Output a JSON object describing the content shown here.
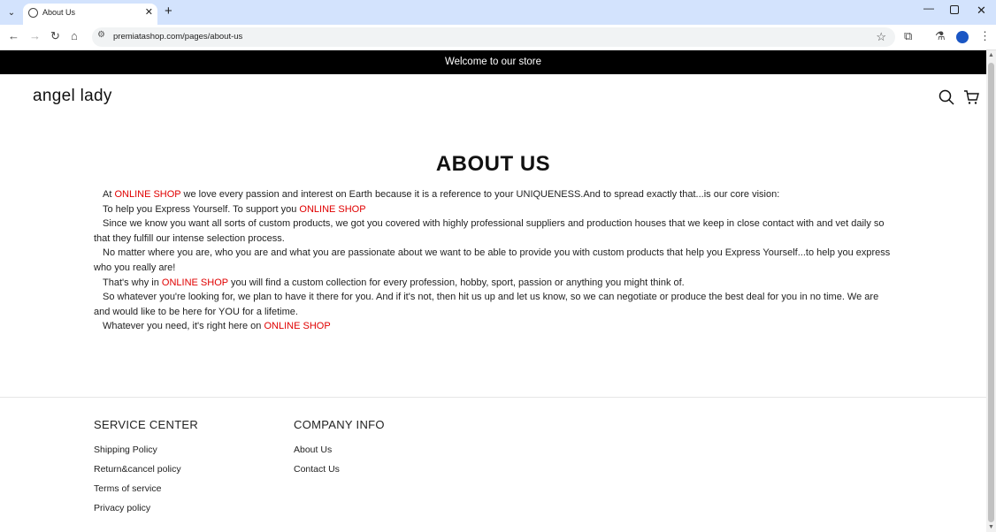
{
  "browser": {
    "tab_title": "About Us",
    "url": "premiatashop.com/pages/about-us"
  },
  "announcement": "Welcome to our store",
  "header": {
    "logo": "angel lady"
  },
  "main": {
    "title": "ABOUT US",
    "paragraphs": [
      {
        "pre": "At ",
        "hl": "ONLINE SHOP",
        "post": " we love every passion and interest on Earth because it is a reference to your UNIQUENESS.And to spread exactly that...is our core vision:"
      },
      {
        "pre": "To help you Express Yourself. To support you ",
        "hl": "ONLINE SHOP",
        "post": ""
      },
      {
        "pre": "Since we know you want all sorts of custom products, we got you covered with highly professional suppliers and production houses that we keep in close contact with and vet daily so that they fulfill our intense selection process.",
        "hl": "",
        "post": ""
      },
      {
        "pre": "No matter where you are, who you are and what you are passionate about we want to be able to provide you with custom products that help you Express Yourself...to help you express who you really are!",
        "hl": "",
        "post": ""
      },
      {
        "pre": "That's why in ",
        "hl": "ONLINE SHOP",
        "post": " you will find a custom collection for every profession, hobby, sport, passion or anything you might think of."
      },
      {
        "pre": "So whatever you're looking for, we plan to have it there for you. And if it's not, then hit us up and let us know, so we can negotiate or produce the best deal for you in no time. We are and would like to be here for YOU for a lifetime.",
        "hl": "",
        "post": ""
      },
      {
        "pre": "Whatever you need, it's right here on ",
        "hl": "ONLINE SHOP",
        "post": ""
      }
    ]
  },
  "footer": {
    "service": {
      "heading": "SERVICE CENTER",
      "links": [
        "Shipping Policy",
        "Return&cancel policy",
        "Terms of service",
        "Privacy policy"
      ]
    },
    "company": {
      "heading": "COMPANY INFO",
      "links": [
        "About Us",
        "Contact Us"
      ]
    }
  },
  "colors": {
    "highlight": "#e00000",
    "announcement_bg": "#000000"
  }
}
